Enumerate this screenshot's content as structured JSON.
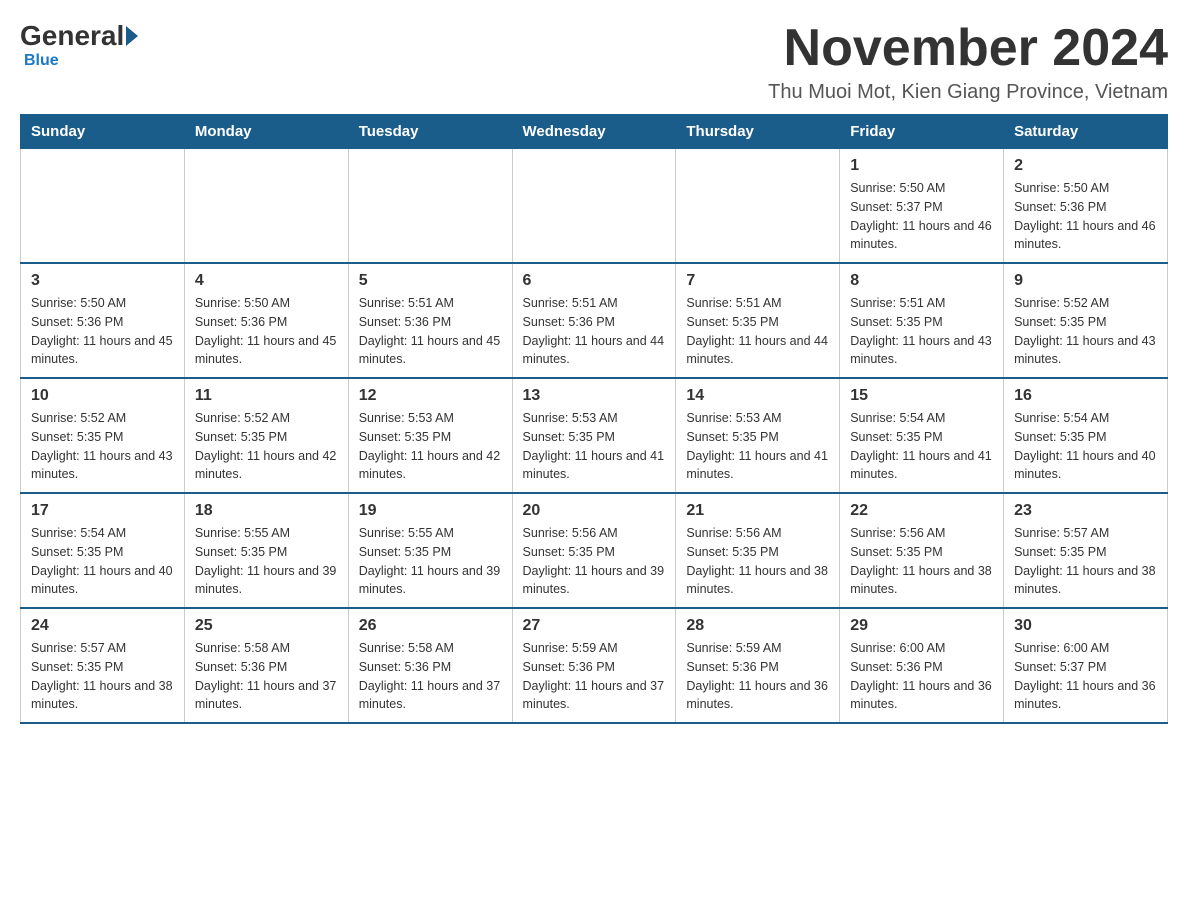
{
  "logo": {
    "general": "General",
    "blue": "Blue"
  },
  "title": {
    "month": "November 2024",
    "location": "Thu Muoi Mot, Kien Giang Province, Vietnam"
  },
  "weekdays": [
    "Sunday",
    "Monday",
    "Tuesday",
    "Wednesday",
    "Thursday",
    "Friday",
    "Saturday"
  ],
  "weeks": [
    [
      {
        "day": "",
        "info": ""
      },
      {
        "day": "",
        "info": ""
      },
      {
        "day": "",
        "info": ""
      },
      {
        "day": "",
        "info": ""
      },
      {
        "day": "",
        "info": ""
      },
      {
        "day": "1",
        "info": "Sunrise: 5:50 AM\nSunset: 5:37 PM\nDaylight: 11 hours and 46 minutes."
      },
      {
        "day": "2",
        "info": "Sunrise: 5:50 AM\nSunset: 5:36 PM\nDaylight: 11 hours and 46 minutes."
      }
    ],
    [
      {
        "day": "3",
        "info": "Sunrise: 5:50 AM\nSunset: 5:36 PM\nDaylight: 11 hours and 45 minutes."
      },
      {
        "day": "4",
        "info": "Sunrise: 5:50 AM\nSunset: 5:36 PM\nDaylight: 11 hours and 45 minutes."
      },
      {
        "day": "5",
        "info": "Sunrise: 5:51 AM\nSunset: 5:36 PM\nDaylight: 11 hours and 45 minutes."
      },
      {
        "day": "6",
        "info": "Sunrise: 5:51 AM\nSunset: 5:36 PM\nDaylight: 11 hours and 44 minutes."
      },
      {
        "day": "7",
        "info": "Sunrise: 5:51 AM\nSunset: 5:35 PM\nDaylight: 11 hours and 44 minutes."
      },
      {
        "day": "8",
        "info": "Sunrise: 5:51 AM\nSunset: 5:35 PM\nDaylight: 11 hours and 43 minutes."
      },
      {
        "day": "9",
        "info": "Sunrise: 5:52 AM\nSunset: 5:35 PM\nDaylight: 11 hours and 43 minutes."
      }
    ],
    [
      {
        "day": "10",
        "info": "Sunrise: 5:52 AM\nSunset: 5:35 PM\nDaylight: 11 hours and 43 minutes."
      },
      {
        "day": "11",
        "info": "Sunrise: 5:52 AM\nSunset: 5:35 PM\nDaylight: 11 hours and 42 minutes."
      },
      {
        "day": "12",
        "info": "Sunrise: 5:53 AM\nSunset: 5:35 PM\nDaylight: 11 hours and 42 minutes."
      },
      {
        "day": "13",
        "info": "Sunrise: 5:53 AM\nSunset: 5:35 PM\nDaylight: 11 hours and 41 minutes."
      },
      {
        "day": "14",
        "info": "Sunrise: 5:53 AM\nSunset: 5:35 PM\nDaylight: 11 hours and 41 minutes."
      },
      {
        "day": "15",
        "info": "Sunrise: 5:54 AM\nSunset: 5:35 PM\nDaylight: 11 hours and 41 minutes."
      },
      {
        "day": "16",
        "info": "Sunrise: 5:54 AM\nSunset: 5:35 PM\nDaylight: 11 hours and 40 minutes."
      }
    ],
    [
      {
        "day": "17",
        "info": "Sunrise: 5:54 AM\nSunset: 5:35 PM\nDaylight: 11 hours and 40 minutes."
      },
      {
        "day": "18",
        "info": "Sunrise: 5:55 AM\nSunset: 5:35 PM\nDaylight: 11 hours and 39 minutes."
      },
      {
        "day": "19",
        "info": "Sunrise: 5:55 AM\nSunset: 5:35 PM\nDaylight: 11 hours and 39 minutes."
      },
      {
        "day": "20",
        "info": "Sunrise: 5:56 AM\nSunset: 5:35 PM\nDaylight: 11 hours and 39 minutes."
      },
      {
        "day": "21",
        "info": "Sunrise: 5:56 AM\nSunset: 5:35 PM\nDaylight: 11 hours and 38 minutes."
      },
      {
        "day": "22",
        "info": "Sunrise: 5:56 AM\nSunset: 5:35 PM\nDaylight: 11 hours and 38 minutes."
      },
      {
        "day": "23",
        "info": "Sunrise: 5:57 AM\nSunset: 5:35 PM\nDaylight: 11 hours and 38 minutes."
      }
    ],
    [
      {
        "day": "24",
        "info": "Sunrise: 5:57 AM\nSunset: 5:35 PM\nDaylight: 11 hours and 38 minutes."
      },
      {
        "day": "25",
        "info": "Sunrise: 5:58 AM\nSunset: 5:36 PM\nDaylight: 11 hours and 37 minutes."
      },
      {
        "day": "26",
        "info": "Sunrise: 5:58 AM\nSunset: 5:36 PM\nDaylight: 11 hours and 37 minutes."
      },
      {
        "day": "27",
        "info": "Sunrise: 5:59 AM\nSunset: 5:36 PM\nDaylight: 11 hours and 37 minutes."
      },
      {
        "day": "28",
        "info": "Sunrise: 5:59 AM\nSunset: 5:36 PM\nDaylight: 11 hours and 36 minutes."
      },
      {
        "day": "29",
        "info": "Sunrise: 6:00 AM\nSunset: 5:36 PM\nDaylight: 11 hours and 36 minutes."
      },
      {
        "day": "30",
        "info": "Sunrise: 6:00 AM\nSunset: 5:37 PM\nDaylight: 11 hours and 36 minutes."
      }
    ]
  ]
}
